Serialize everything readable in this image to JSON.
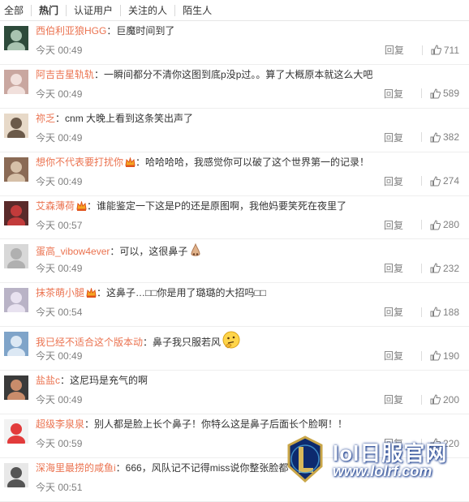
{
  "tabs": [
    "全部",
    "热门",
    "认证用户",
    "关注的人",
    "陌生人"
  ],
  "active_tab": 1,
  "labels": {
    "reply": "回复"
  },
  "colors": {
    "username": "#eb7350",
    "meta": "#808080",
    "text": "#333333"
  },
  "comments": [
    {
      "user": "西伯利亚狼HGG",
      "vip": false,
      "text": "：巨魔时间到了",
      "emoji": "",
      "time": "今天 00:49",
      "likes": "711"
    },
    {
      "user": "阿吉吉星轨轨",
      "vip": false,
      "text": "：一瞬间都分不清你这图到底p没p过。。算了大概原本就这么大吧",
      "emoji": "",
      "time": "今天 00:49",
      "likes": "589"
    },
    {
      "user": "祢乏",
      "vip": false,
      "text": "：cnm 大晚上看到这条笑出声了",
      "emoji": "",
      "time": "今天 00:49",
      "likes": "382"
    },
    {
      "user": "想你不代表要打扰你",
      "vip": true,
      "text": "：哈哈哈哈，我感觉你可以破了这个世界第一的记录！",
      "emoji": "",
      "time": "今天 00:49",
      "likes": "274"
    },
    {
      "user": "艾森薄荷",
      "vip": true,
      "text": "：谁能鉴定一下这是P的还是原图啊，我他妈要笑死在夜里了",
      "emoji": "",
      "time": "今天 00:57",
      "likes": "280"
    },
    {
      "user": "蛋高_vibow4ever",
      "vip": false,
      "text": "：可以，这很鼻子",
      "emoji": "nose-emoji",
      "time": "今天 00:49",
      "likes": "232"
    },
    {
      "user": "抹茶萌小腿",
      "vip": true,
      "text": "：这鼻子…□□你是用了璐璐的大招吗□□",
      "emoji": "",
      "time": "今天 00:54",
      "likes": "188"
    },
    {
      "user": "我已经不适合这个版本动",
      "vip": false,
      "text": "：鼻子我只服若风",
      "emoji": "thinking-emoji",
      "time": "今天 00:49",
      "likes": "190"
    },
    {
      "user": "盐盐c",
      "vip": false,
      "text": "：这尼玛是充气的啊",
      "emoji": "",
      "time": "今天 00:49",
      "likes": "200"
    },
    {
      "user": "超级李泉泉",
      "vip": false,
      "text": "：别人都是脸上长个鼻子！你特么这是鼻子后面长个脸啊！！",
      "emoji": "",
      "time": "今天 00:59",
      "likes": "220"
    },
    {
      "user": "深海里最捞的咸鱼i",
      "vip": false,
      "text": "：666，风队记不记得miss说你整张脸都",
      "emoji": "",
      "time": "今天 00:51",
      "likes": ""
    }
  ],
  "watermark": {
    "title": "lol日服官网",
    "url": "www.lolrf.com"
  }
}
